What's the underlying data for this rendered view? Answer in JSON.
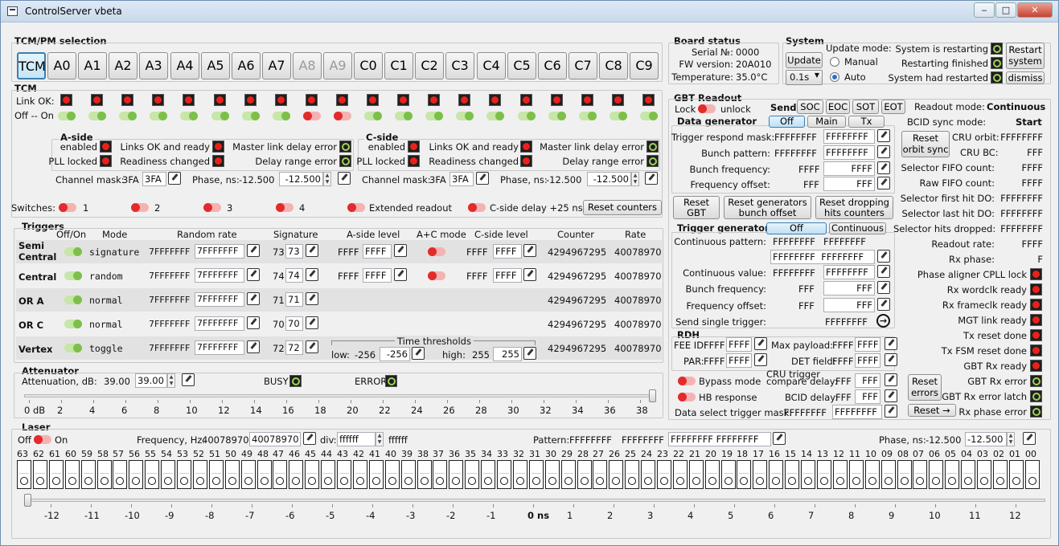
{
  "window": {
    "title": "ControlServer vbeta"
  },
  "tcm_pm": {
    "title": "TCM/PM selection",
    "buttons": [
      "TCM",
      "A0",
      "A1",
      "A2",
      "A3",
      "A4",
      "A5",
      "A6",
      "A7",
      "A8",
      "A9",
      "C0",
      "C1",
      "C2",
      "C3",
      "C4",
      "C5",
      "C6",
      "C7",
      "C8",
      "C9"
    ]
  },
  "board": {
    "title": "Board status",
    "serial_label": "Serial №:",
    "serial": "0000",
    "fw_label": "FW version:",
    "fw": "20A010",
    "temp_label": "Temperature:",
    "temp": "35.0°C"
  },
  "system": {
    "title": "System",
    "update_btn": "Update",
    "update_interval": "0.1s",
    "update_mode_label": "Update mode:",
    "manual": "Manual",
    "auto": "Auto",
    "restarting": "System is restarting",
    "restart_finished": "Restarting finished",
    "had_restarted": "System had restarted",
    "restart_btn": "Restart system",
    "dismiss_btn": "dismiss"
  },
  "tcm": {
    "title": "TCM",
    "link_ok": "Link OK:",
    "off_on": "Off -- On",
    "aside": {
      "title": "A-side",
      "enabled": "enabled",
      "pll": "PLL locked",
      "links_ok": "Links OK and ready",
      "readiness": "Readiness changed",
      "master_delay": "Master link delay error",
      "delay_range": "Delay range error",
      "channel_mask_label": "Channel mask:",
      "channel_mask": "3FA",
      "channel_mask_in": "3FA",
      "phase_label": "Phase, ns:",
      "phase": "-12.500",
      "phase_in": "-12.500"
    },
    "cside": {
      "title": "C-side",
      "enabled": "enabled",
      "pll": "PLL locked",
      "links_ok": "Links OK and ready",
      "readiness": "Readiness changed",
      "master_delay": "Master link delay error",
      "delay_range": "Delay range error",
      "channel_mask_label": "Channel mask:",
      "channel_mask": "3FA",
      "channel_mask_in": "3FA",
      "phase_label": "Phase, ns:",
      "phase": "-12.500",
      "phase_in": "-12.500"
    },
    "switches_label": "Switches:",
    "switches": [
      "1",
      "2",
      "3",
      "4"
    ],
    "extended": "Extended readout",
    "cdelay": "C-side delay +25 ns",
    "reset_counters": "Reset counters"
  },
  "triggers": {
    "title": "Triggers",
    "headers": [
      "Off/On",
      "Mode",
      "Random rate",
      "Signature",
      "A-side level",
      "A+C mode",
      "C-side level",
      "Counter",
      "Rate"
    ],
    "rows": [
      {
        "name": "Semi Central",
        "mode": "signature",
        "rate": "7FFFFFFF",
        "rate_in": "7FFFFFFF",
        "sig": "73",
        "sig_in": "73",
        "alevel": "FFFF",
        "alevel_in": "FFFF",
        "clevel": "FFFF",
        "clevel_in": "FFFF",
        "counter": "4294967295",
        "rateval": "40078970"
      },
      {
        "name": "Central",
        "mode": "random",
        "rate": "7FFFFFFF",
        "rate_in": "7FFFFFFF",
        "sig": "74",
        "sig_in": "74",
        "alevel": "FFFF",
        "alevel_in": "FFFF",
        "clevel": "FFFF",
        "clevel_in": "FFFF",
        "counter": "4294967295",
        "rateval": "40078970"
      },
      {
        "name": "OR A",
        "mode": "normal",
        "rate": "7FFFFFFF",
        "rate_in": "7FFFFFFF",
        "sig": "71",
        "sig_in": "71",
        "counter": "4294967295",
        "rateval": "40078970"
      },
      {
        "name": "OR C",
        "mode": "normal",
        "rate": "7FFFFFFF",
        "rate_in": "7FFFFFFF",
        "sig": "70",
        "sig_in": "70",
        "counter": "4294967295",
        "rateval": "40078970"
      },
      {
        "name": "Vertex",
        "mode": "toggle",
        "rate": "7FFFFFFF",
        "rate_in": "7FFFFFFF",
        "sig": "72",
        "sig_in": "72",
        "counter": "4294967295",
        "rateval": "40078970"
      }
    ],
    "time_thresholds": "Time thresholds",
    "low_label": "low:",
    "low": "-256",
    "low_in": "-256",
    "high_label": "high:",
    "high": "255",
    "high_in": "255"
  },
  "attenuator": {
    "title": "Attenuator",
    "label": "Attenuation, dB:",
    "value": "39.00",
    "value_in": "39.00",
    "busy": "BUSY",
    "error": "ERROR",
    "level_fraction": 1.0,
    "scale": [
      "0  dB",
      "2",
      "4",
      "6",
      "8",
      "10",
      "12",
      "14",
      "16",
      "18",
      "20",
      "22",
      "24",
      "26",
      "28",
      "30",
      "32",
      "34",
      "36",
      "38"
    ]
  },
  "laser": {
    "title": "Laser",
    "off": "Off",
    "on": "On",
    "freq_label": "Frequency, Hz:",
    "freq": "40078970",
    "freq_in": "40078970",
    "div_label": "div:",
    "div_in": "ffffff",
    "div": "ffffff",
    "pattern_label": "Pattern:",
    "pattern": "FFFFFFFF",
    "pattern2": "FFFFFFFF",
    "pattern_in": "FFFFFFFF",
    "pattern_in2": "FFFFFFFF",
    "phase_label": "Phase, ns:",
    "phase": "-12.500",
    "phase_in": "-12.500",
    "bits": [
      "63",
      "62",
      "61",
      "60",
      "59",
      "58",
      "57",
      "56",
      "55",
      "54",
      "53",
      "52",
      "51",
      "50",
      "49",
      "48",
      "47",
      "46",
      "45",
      "44",
      "43",
      "42",
      "41",
      "40",
      "39",
      "38",
      "37",
      "36",
      "35",
      "34",
      "33",
      "32",
      "31",
      "30",
      "29",
      "28",
      "27",
      "26",
      "25",
      "24",
      "23",
      "22",
      "21",
      "20",
      "19",
      "18",
      "17",
      "16",
      "15",
      "14",
      "13",
      "12",
      "11",
      "10",
      "09",
      "08",
      "07",
      "06",
      "05",
      "04",
      "03",
      "02",
      "01",
      "00"
    ],
    "ns_scale": [
      "-12",
      "-11",
      "-10",
      "-9",
      "-8",
      "-7",
      "-6",
      "-5",
      "-4",
      "-3",
      "-2",
      "-1",
      "0 ns",
      "1",
      "2",
      "3",
      "4",
      "5",
      "6",
      "7",
      "8",
      "9",
      "10",
      "11",
      "12"
    ],
    "phase_fraction": 0.0
  },
  "gbt": {
    "title": "GBT Readout",
    "lock": "Lock",
    "unlock": "unlock",
    "send_label": "Send:",
    "send": [
      "SOC",
      "EOC",
      "SOT",
      "EOT"
    ],
    "readout_mode_label": "Readout mode:",
    "readout_mode": "Continuous",
    "bcid_label": "BCID sync mode:",
    "bcid": "Start",
    "datagen": {
      "title": "Data generator",
      "modes": [
        "Off",
        "Main",
        "Tx"
      ],
      "trig_mask_label": "Trigger respond mask:",
      "trig_mask": "FFFFFFFF",
      "trig_mask_in": "FFFFFFFF",
      "bunch_pattern_label": "Bunch pattern:",
      "bunch_pattern": "FFFFFFFF",
      "bunch_pattern_in": "FFFFFFFF",
      "bunch_freq_label": "Bunch frequency:",
      "bunch_freq": "FFFF",
      "bunch_freq_in": "FFFF",
      "freq_offset_label": "Frequency offset:",
      "freq_offset": "FFF",
      "freq_offset_in": "FFF"
    },
    "reset_gbt": "Reset GBT",
    "reset_gen": "Reset generators bunch offset",
    "reset_drop": "Reset dropping hits counters",
    "triggen": {
      "title": "Trigger generator",
      "modes": [
        "Off",
        "Continuous"
      ],
      "cont_pattern_label": "Continuous pattern:",
      "cont_pattern": "FFFFFFFF",
      "cont_pattern2": "FFFFFFFF",
      "cont_pattern_in": "FFFFFFFF",
      "cont_pattern_in2": "FFFFFFFF",
      "cont_value_label": "Continuous value:",
      "cont_value": "FFFFFFFF",
      "cont_value_in": "FFFFFFFF",
      "bunch_freq_label": "Bunch frequency:",
      "bunch_freq": "FFF",
      "bunch_freq_in": "FFF",
      "freq_offset_label": "Frequency offset:",
      "freq_offset": "FFF",
      "freq_offset_in": "FFF",
      "single_label": "Send single trigger:",
      "single": "FFFFFFFF"
    },
    "rdh": {
      "title": "RDH",
      "fee_label": "FEE ID:",
      "fee": "FFFF",
      "fee_in": "FFFF",
      "max_payload_label": "Max payload:",
      "max_payload": "FFFF",
      "max_payload_in": "FFFF",
      "par_label": "PAR:",
      "par": "FFFF",
      "par_in": "FFFF",
      "det_label": "DET field:",
      "det": "FFFF",
      "det_in": "FFFF"
    },
    "bypass": "Bypass mode",
    "hb": "HB response",
    "cru_trigger": "CRU trigger",
    "compare_label": "compare delay:",
    "compare": "FFF",
    "compare_in": "FFF",
    "bcid_delay_label": "BCID delay:",
    "bcid_delay": "FFF",
    "bcid_delay_in": "FFF",
    "dstm_label": "Data select trigger mask:",
    "dstm": "FFFFFFFF",
    "dstm_in": "FFFFFFFF",
    "reset_orbit": "Reset orbit sync",
    "cru_orbit_label": "CRU orbit:",
    "cru_orbit": "FFFFFFFF",
    "cru_bc_label": "CRU BC:",
    "cru_bc": "FFF",
    "stats": [
      {
        "label": "Selector FIFO count:",
        "value": "FFFF"
      },
      {
        "label": "Raw FIFO count:",
        "value": "FFFF"
      },
      {
        "label": "Selector first hit DO:",
        "value": "FFFFFFFF"
      },
      {
        "label": "Selector last hit DO:",
        "value": "FFFFFFFF"
      },
      {
        "label": "Selector hits dropped:",
        "value": "FFFFFFFF"
      },
      {
        "label": "Readout rate:",
        "value": "FFFF"
      },
      {
        "label": "Rx phase:",
        "value": "F"
      }
    ],
    "flags": [
      "Phase aligner CPLL lock",
      "Rx wordclk ready",
      "Rx frameclk ready",
      "MGT link ready",
      "Tx reset done",
      "Tx FSM reset done",
      "GBT Rx ready",
      "GBT Rx error",
      "GBT Rx error latch",
      "Rx phase error"
    ],
    "reset_errors": "Reset errors",
    "reset_arrow": "Reset →"
  },
  "colors": {
    "led_red": "#e8211b",
    "led_green": "#9fd45a",
    "accent": "#3c7fb1"
  }
}
